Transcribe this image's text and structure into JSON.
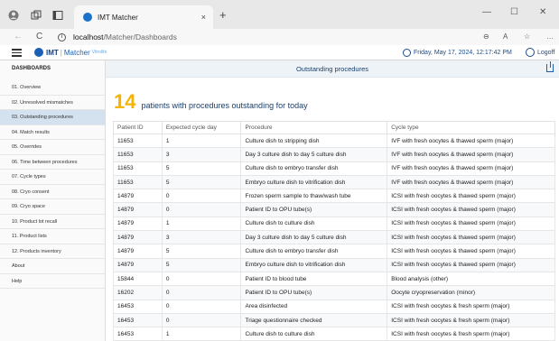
{
  "browser": {
    "tab_title": "IMT Matcher",
    "tab_close": "×",
    "new_tab": "+",
    "url_host": "localhost",
    "url_path": "/Matcher/Dashboards",
    "win_min": "—",
    "win_max": "☐",
    "win_close": "✕",
    "back": "←",
    "reload": "C",
    "zoom": "⊖",
    "read": "A",
    "fav": "☆",
    "more": "…"
  },
  "app": {
    "logo_imt": "IMT",
    "logo_sep": "|",
    "logo_matcher": "Matcher",
    "logo_brand": "Vitrolife",
    "datetime": "Friday, May 17, 2024, 12:17:42 PM",
    "logoff": "Logoff"
  },
  "sidebar": {
    "title": "DASHBOARDS",
    "items": [
      {
        "label": "01. Overview"
      },
      {
        "label": "02. Unresolved mismatches"
      },
      {
        "label": "03. Outstanding procedures"
      },
      {
        "label": "04. Match results"
      },
      {
        "label": "05. Overrides"
      },
      {
        "label": "06. Time between procedures"
      },
      {
        "label": "07. Cycle types"
      },
      {
        "label": "08. Cryo consent"
      },
      {
        "label": "09. Cryo space"
      },
      {
        "label": "10. Product lot recall"
      },
      {
        "label": "11. Product lists"
      },
      {
        "label": "12. Products inventory"
      },
      {
        "label": "About"
      },
      {
        "label": "Help"
      }
    ],
    "active_index": 2
  },
  "main": {
    "header": "Outstanding procedures",
    "count": "14",
    "summary_text": "patients with procedures outstanding for today",
    "columns": [
      "Patient ID",
      "Expected cycle day",
      "Procedure",
      "Cycle type"
    ],
    "rows": [
      [
        "11653",
        "1",
        "Culture dish to stripping dish",
        "IVF with fresh oocytes & thawed sperm (major)"
      ],
      [
        "11653",
        "3",
        "Day 3 culture dish to day 5 culture dish",
        "IVF with fresh oocytes & thawed sperm (major)"
      ],
      [
        "11653",
        "5",
        "Culture dish to embryo transfer dish",
        "IVF with fresh oocytes & thawed sperm (major)"
      ],
      [
        "11653",
        "5",
        "Embryo culture dish to vitrification dish",
        "IVF with fresh oocytes & thawed sperm (major)"
      ],
      [
        "14879",
        "0",
        "Frozen sperm sample to thaw/wash tube",
        "ICSI with fresh oocytes & thawed sperm (major)"
      ],
      [
        "14879",
        "0",
        "Patient ID to OPU tube(s)",
        "ICSI with fresh oocytes & thawed sperm (major)"
      ],
      [
        "14879",
        "1",
        "Culture dish to culture dish",
        "ICSI with fresh oocytes & thawed sperm (major)"
      ],
      [
        "14879",
        "3",
        "Day 3 culture dish to day 5 culture dish",
        "ICSI with fresh oocytes & thawed sperm (major)"
      ],
      [
        "14879",
        "5",
        "Culture dish to embryo transfer dish",
        "ICSI with fresh oocytes & thawed sperm (major)"
      ],
      [
        "14879",
        "5",
        "Embryo culture dish to vitrification dish",
        "ICSI with fresh oocytes & thawed sperm (major)"
      ],
      [
        "15844",
        "0",
        "Patient ID to blood tube",
        "Blood analysis (other)"
      ],
      [
        "16202",
        "0",
        "Patient ID to OPU tube(s)",
        "Oocyte cryopreservation (minor)"
      ],
      [
        "16453",
        "0",
        "Area disinfected",
        "ICSI with fresh oocytes & fresh sperm (major)"
      ],
      [
        "16453",
        "0",
        "Triage questionnaire checked",
        "ICSI with fresh oocytes & fresh sperm (major)"
      ],
      [
        "16453",
        "1",
        "Culture dish to culture dish",
        "ICSI with fresh oocytes & fresh sperm (major)"
      ]
    ]
  }
}
